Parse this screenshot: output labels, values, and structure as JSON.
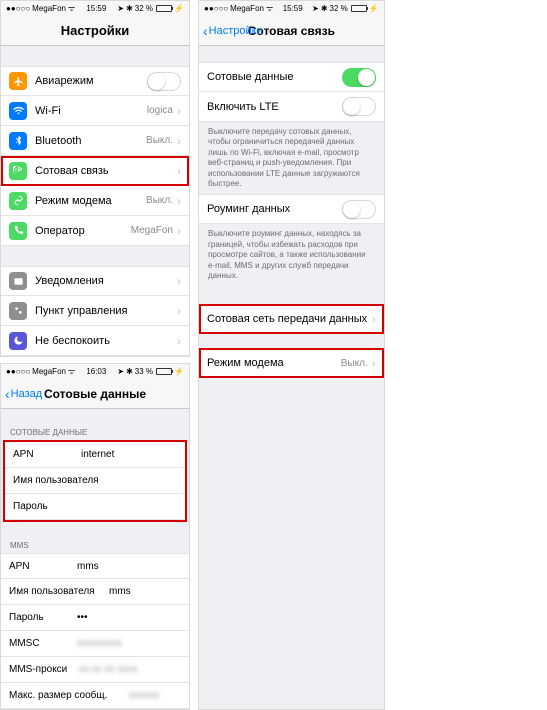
{
  "status": {
    "carrier": "MegaFon",
    "wifi": "⌃",
    "time1": "15:59",
    "time2": "15:59",
    "time3": "16:03",
    "loc": "➤",
    "bt": "✱",
    "pct1": "32 %",
    "pct2": "32 %",
    "pct3": "33 %"
  },
  "screen1": {
    "title": "Настройки",
    "rows": [
      {
        "icon": "plane",
        "color": "#ff9500",
        "label": "Авиарежим",
        "toggle": "off"
      },
      {
        "icon": "wifi",
        "color": "#007aff",
        "label": "Wi-Fi",
        "value": "logica"
      },
      {
        "icon": "bt",
        "color": "#007aff",
        "label": "Bluetooth",
        "value": "Выкл."
      },
      {
        "icon": "cell",
        "color": "#4cd964",
        "label": "Сотовая связь",
        "highlight": true
      },
      {
        "icon": "link",
        "color": "#4cd964",
        "label": "Режим модема",
        "value": "Выкл."
      },
      {
        "icon": "phone",
        "color": "#4cd964",
        "label": "Оператор",
        "value": "MegaFon"
      }
    ],
    "rows2": [
      {
        "icon": "notif",
        "color": "#8e8e93",
        "label": "Уведомления"
      },
      {
        "icon": "cc",
        "color": "#8e8e93",
        "label": "Пункт управления"
      },
      {
        "icon": "moon",
        "color": "#5856d6",
        "label": "Не беспокоить"
      }
    ]
  },
  "screen2": {
    "back": "Настройки",
    "title": "Сотовая связь",
    "r1": {
      "label": "Сотовые данные"
    },
    "r2": {
      "label": "Включить LTE"
    },
    "desc1": "Выключите передачу сотовых данных, чтобы ограничиться передачей данных лишь по Wi-Fi, включая e-mail, просмотр веб-страниц и push-уведомления. При использовании LTE данные загружаются быстрее.",
    "r3": {
      "label": "Роуминг данных"
    },
    "desc2": "Выключите роуминг данных, находясь за границей, чтобы избежать расходов при просмотре сайтов, а также использовании e-mail, MMS и других служб передачи данных.",
    "r4": {
      "label": "Сотовая сеть передачи данных"
    },
    "r5": {
      "label": "Режим модема",
      "value": "Выкл."
    }
  },
  "screen3": {
    "back": "Назад",
    "title": "Сотовые данные",
    "h1": "СОТОВЫЕ ДАННЫЕ",
    "f1": [
      {
        "l": "APN",
        "v": "internet"
      },
      {
        "l": "Имя пользователя",
        "v": ""
      },
      {
        "l": "Пароль",
        "v": ""
      }
    ],
    "h2": "MMS",
    "f2": [
      {
        "l": "APN",
        "v": "mms"
      },
      {
        "l": "Имя пользователя",
        "v": "mms"
      },
      {
        "l": "Пароль",
        "v": "•••"
      },
      {
        "l": "MMSC",
        "v": "xxxxxxxxx",
        "blur": true
      },
      {
        "l": "MMS-прокси",
        "v": "xx xx xx xxxx",
        "blur": true
      },
      {
        "l": "Макс. размер сообщ.",
        "v": "xxxxxx",
        "blur": true
      }
    ]
  }
}
